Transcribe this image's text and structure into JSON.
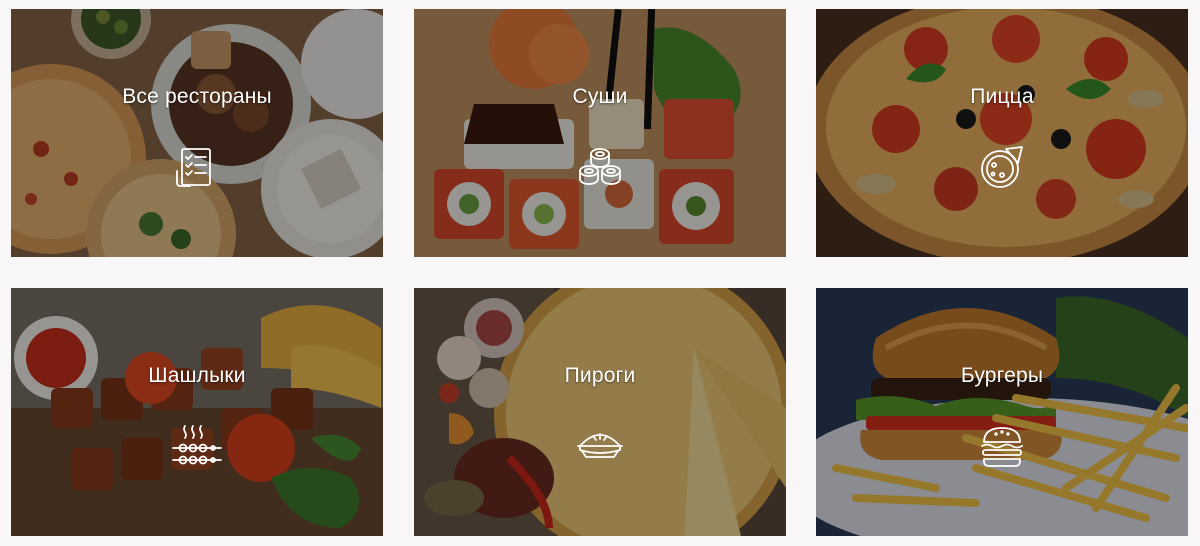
{
  "categories": [
    {
      "label": "Все рестораны",
      "icon": "checklist-icon"
    },
    {
      "label": "Суши",
      "icon": "sushi-rolls-icon"
    },
    {
      "label": "Пицца",
      "icon": "pizza-icon"
    },
    {
      "label": "Шашлыки",
      "icon": "skewers-icon"
    },
    {
      "label": "Пироги",
      "icon": "pie-icon"
    },
    {
      "label": "Бургеры",
      "icon": "burger-icon"
    }
  ],
  "colors": {
    "page_background": "#f8f6f7",
    "label_text": "#ffffff",
    "icon_stroke": "#ffffff"
  }
}
